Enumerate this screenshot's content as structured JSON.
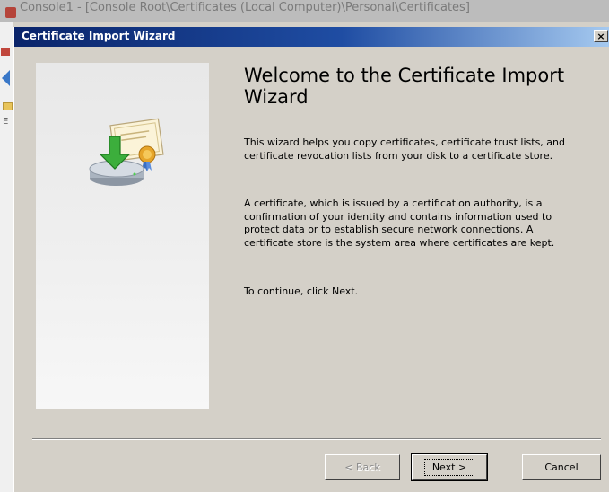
{
  "background_window": {
    "title": "Console1 - [Console Root\\Certificates (Local Computer)\\Personal\\Certificates]",
    "tree_letter": "E"
  },
  "dialog": {
    "title": "Certificate Import Wizard",
    "close_label": "×"
  },
  "content": {
    "heading": "Welcome to the Certificate Import Wizard",
    "paragraph1": "This wizard helps you copy certificates, certificate trust lists, and certificate revocation lists from your disk to a certificate store.",
    "paragraph2": "A certificate, which is issued by a certification authority, is a confirmation of your identity and contains information used to protect data or to establish secure network connections. A certificate store is the system area where certificates are kept.",
    "paragraph3": "To continue, click Next."
  },
  "buttons": {
    "back": "< Back",
    "next": "Next >",
    "cancel": "Cancel"
  },
  "icons": {
    "wizard_graphic": "certificate-import-icon",
    "back_nav": "back-arrow-icon",
    "folder": "folder-icon"
  },
  "colors": {
    "titlebar_start": "#0a246a",
    "titlebar_end": "#a6caf0",
    "dialog_bg": "#d4d0c8",
    "disabled_text": "#8a8a8a"
  },
  "state": {
    "back_enabled": false,
    "default_button": "next"
  }
}
